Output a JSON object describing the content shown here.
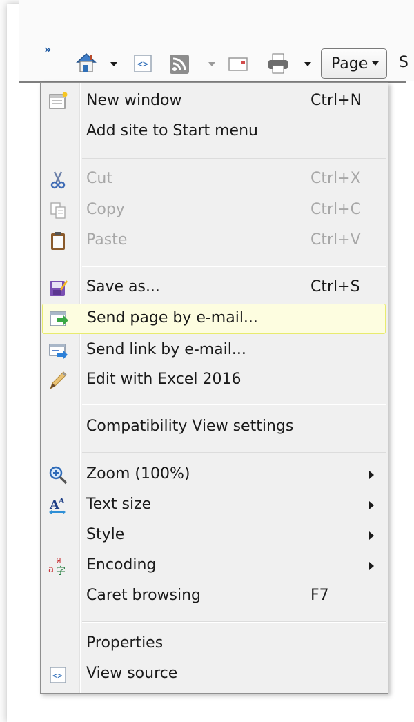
{
  "toolbar": {
    "overflow_glyph": "»",
    "page_button_label": "Page",
    "next_button_peek": "S",
    "icons": [
      "home-icon",
      "web-slice-icon",
      "rss-feed-icon",
      "read-mail-icon",
      "print-icon"
    ]
  },
  "menu": {
    "items": [
      {
        "label": "New window",
        "shortcut": "Ctrl+N",
        "icon": "new-window-icon",
        "disabled": false
      },
      {
        "label": "Add site to Start menu",
        "shortcut": "",
        "icon": "",
        "disabled": false
      },
      {
        "label": "Cut",
        "shortcut": "Ctrl+X",
        "icon": "scissors-icon",
        "disabled": true
      },
      {
        "label": "Copy",
        "shortcut": "Ctrl+C",
        "icon": "copy-icon",
        "disabled": true
      },
      {
        "label": "Paste",
        "shortcut": "Ctrl+V",
        "icon": "clipboard-icon",
        "disabled": true
      },
      {
        "label": "Save as...",
        "shortcut": "Ctrl+S",
        "icon": "save-icon",
        "disabled": false
      },
      {
        "label": "Send page by e-mail...",
        "shortcut": "",
        "icon": "send-page-icon",
        "disabled": false,
        "highlighted": true
      },
      {
        "label": "Send link by e-mail...",
        "shortcut": "",
        "icon": "send-link-icon",
        "disabled": false
      },
      {
        "label": "Edit with Excel 2016",
        "shortcut": "",
        "icon": "pencil-icon",
        "disabled": false
      },
      {
        "label": "Compatibility View settings",
        "shortcut": "",
        "icon": "",
        "disabled": false
      },
      {
        "label": "Zoom (100%)",
        "shortcut": "",
        "icon": "zoom-icon",
        "disabled": false,
        "submenu": true
      },
      {
        "label": "Text size",
        "shortcut": "",
        "icon": "text-size-icon",
        "disabled": false,
        "submenu": true
      },
      {
        "label": "Style",
        "shortcut": "",
        "icon": "",
        "disabled": false,
        "submenu": true
      },
      {
        "label": "Encoding",
        "shortcut": "",
        "icon": "encoding-icon",
        "disabled": false,
        "submenu": true
      },
      {
        "label": "Caret browsing",
        "shortcut": "F7",
        "icon": "",
        "disabled": false
      },
      {
        "label": "Properties",
        "shortcut": "",
        "icon": "",
        "disabled": false
      },
      {
        "label": "View source",
        "shortcut": "",
        "icon": "view-source-icon",
        "disabled": false
      }
    ]
  },
  "colors": {
    "highlight_bg": "#fdfde0",
    "highlight_border": "#e8eb6e",
    "disabled_text": "#a7a7a7",
    "menu_bg": "#f0f0f0"
  }
}
